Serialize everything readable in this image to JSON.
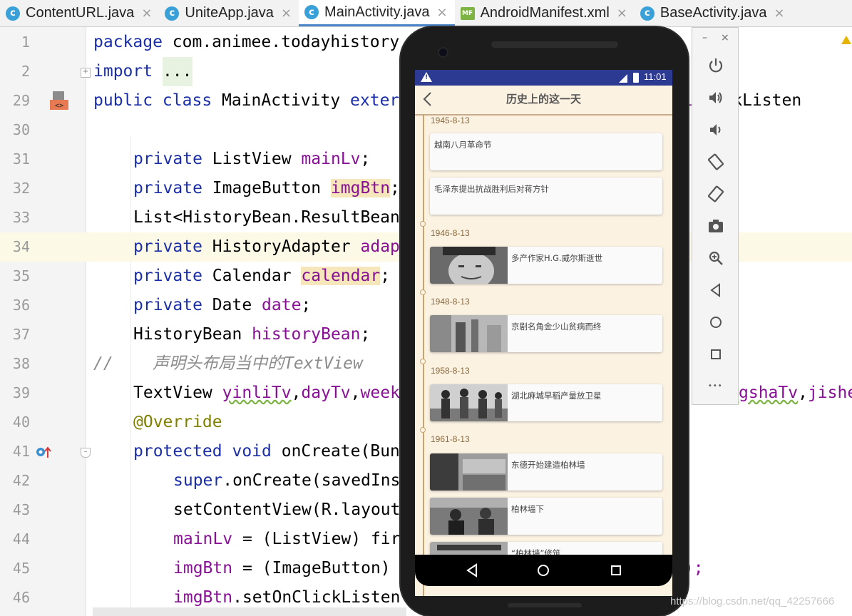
{
  "tabs": [
    {
      "label": "ContentURL.java",
      "icon": "class-icon",
      "active": false
    },
    {
      "label": "UniteApp.java",
      "icon": "class-icon",
      "active": false
    },
    {
      "label": "MainActivity.java",
      "icon": "class-icon",
      "active": true
    },
    {
      "label": "AndroidManifest.xml",
      "icon": "manifest-icon",
      "active": false
    },
    {
      "label": "BaseActivity.java",
      "icon": "class-icon",
      "active": false
    }
  ],
  "tab_icon_letter": "c",
  "tab_mf_letter": "MF",
  "close_glyph": "×",
  "line_numbers": [
    "1",
    "2",
    "29",
    "30",
    "31",
    "32",
    "33",
    "34",
    "35",
    "36",
    "37",
    "38",
    "39",
    "40",
    "41",
    "42",
    "43",
    "44",
    "45",
    "46"
  ],
  "code": {
    "l1_kw": "package",
    "l1_rest": " com.animee.todayhistory",
    "l2_kw": "import",
    "l2_fold": "...",
    "l29_a": "public class",
    "l29_b": " MainActivity ",
    "l29_c": "exter",
    "l29_right": "ClickListen",
    "l29_right_prefix": "i",
    "l31_kw": "private",
    "l31_type": " ListView ",
    "l31_fld": "mainLv",
    "l31_end": ";",
    "l32_kw": "private",
    "l32_type": " ImageButton ",
    "l32_fld": "imgBtn",
    "l32_end": ";",
    "l33": "List<HistoryBean.ResultBean",
    "l34_kw": "private",
    "l34_type": " HistoryAdapter ",
    "l34_fld": "adap",
    "l35_kw": "private",
    "l35_type": " Calendar ",
    "l35_fld": "calendar",
    "l35_end": ";",
    "l36_kw": "private",
    "l36_type": " Date ",
    "l36_fld": "date",
    "l36_end": ";",
    "l37_type": "HistoryBean ",
    "l37_fld": "historyBean",
    "l37_end": ";",
    "l38_cmt": "//    声明头布局当中的TextView",
    "l39_type": "TextView ",
    "l39_f1": "yinliTv",
    "l39_c1": ",",
    "l39_f2": "dayTv",
    "l39_c2": ",",
    "l39_f3": "week",
    "l39_right_dot": ",",
    "l39_right_f1": "gshaTv",
    "l39_right_c": ",",
    "l39_right_f2": "jishe",
    "l40_ann": "@Override",
    "l41_kw": "protected void",
    "l41_rest": " onCreate(Bun",
    "l42_kw": "super",
    "l42_rest": ".onCreate(savedIns",
    "l43": "setContentView(R.layout",
    "l44_fld": "mainLv",
    "l44_rest": " = (ListView) fir",
    "l45_fld": "imgBtn",
    "l45_rest": " = (ImageButton)",
    "l45_right": "n);",
    "l46_fld": "imgBtn",
    "l46_rest": ".setOnClickListen"
  },
  "emulator": {
    "status_time": "11:01",
    "status_warn_mark": "!",
    "app_title": "历史上的这一天",
    "events": [
      {
        "date": "1945-8-13",
        "items": [
          {
            "text": "越南八月革命节",
            "thumb": false
          },
          {
            "text": "毛泽东提出抗战胜利后对蒋方针",
            "thumb": false
          }
        ]
      },
      {
        "date": "1946-8-13",
        "items": [
          {
            "text": "多产作家H.G.威尔斯逝世",
            "thumb": true
          }
        ]
      },
      {
        "date": "1948-8-13",
        "items": [
          {
            "text": "京剧名角金少山贫病而终",
            "thumb": true
          }
        ]
      },
      {
        "date": "1958-8-13",
        "items": [
          {
            "text": "湖北麻城早稻产量放卫星",
            "thumb": true
          }
        ]
      },
      {
        "date": "1961-8-13",
        "items": [
          {
            "text": "东德开始建造柏林墙",
            "thumb": true
          },
          {
            "text": "柏林墙下",
            "thumb": true
          },
          {
            "text": "“柏林墙”修筑",
            "thumb": true
          }
        ]
      }
    ]
  },
  "controls": {
    "minimize": "–",
    "close": "×",
    "more": "•••"
  },
  "watermark": "https://blog.csdn.net/qq_42257666",
  "colors": {
    "keyword": "#1a2ea8",
    "field": "#871094",
    "highlight": "#f5e6bc",
    "annotation": "#808000",
    "status_bar": "#2d3a91",
    "app_bg": "#fbf2e2"
  }
}
